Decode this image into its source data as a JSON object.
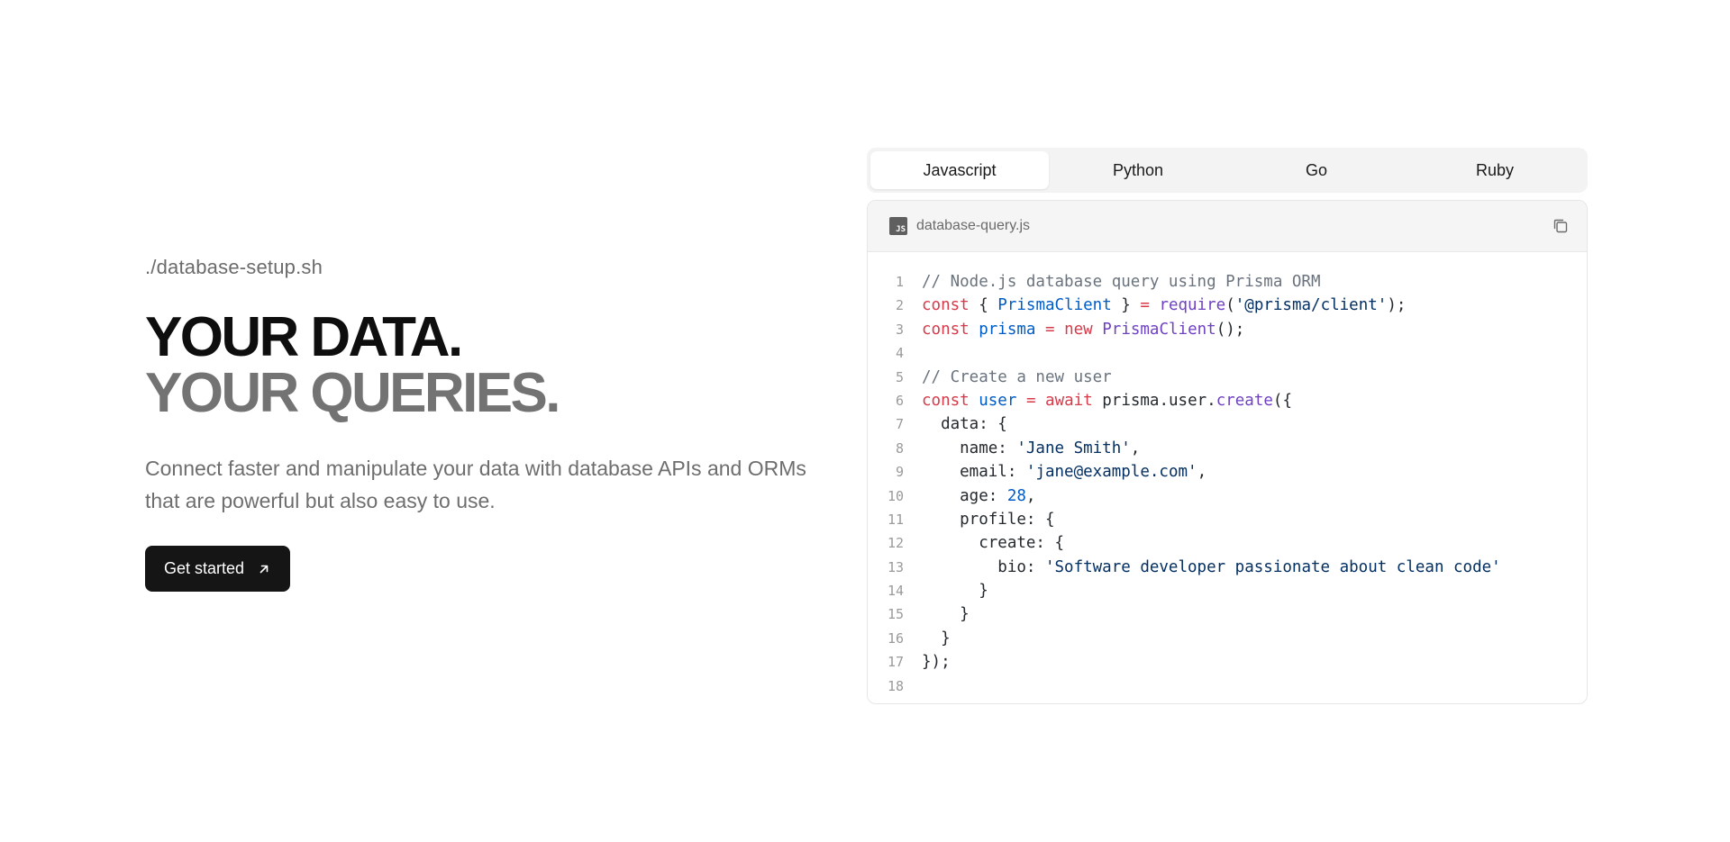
{
  "hero": {
    "filename": "./database-setup.sh",
    "headline_line1": "YOUR DATA.",
    "headline_line2": "YOUR QUERIES.",
    "subtitle": "Connect faster and manipulate your data with database APIs and ORMs that are powerful but also easy to use.",
    "cta_label": "Get started"
  },
  "tabs": [
    {
      "label": "Javascript",
      "active": true
    },
    {
      "label": "Python",
      "active": false
    },
    {
      "label": "Go",
      "active": false
    },
    {
      "label": "Ruby",
      "active": false
    }
  ],
  "editor": {
    "file_badge": "JS",
    "file_name": "database-query.js",
    "copy_icon": "copy-icon",
    "lines": [
      [
        {
          "t": "// Node.js database query using Prisma ORM",
          "k": "comment"
        }
      ],
      [
        {
          "t": "const",
          "k": "kw"
        },
        {
          "t": " { ",
          "k": "plain"
        },
        {
          "t": "PrismaClient",
          "k": "var"
        },
        {
          "t": " } ",
          "k": "plain"
        },
        {
          "t": "=",
          "k": "kw"
        },
        {
          "t": " ",
          "k": "plain"
        },
        {
          "t": "require",
          "k": "fn"
        },
        {
          "t": "(",
          "k": "plain"
        },
        {
          "t": "'@prisma/client'",
          "k": "str"
        },
        {
          "t": ");",
          "k": "plain"
        }
      ],
      [
        {
          "t": "const",
          "k": "kw"
        },
        {
          "t": " ",
          "k": "plain"
        },
        {
          "t": "prisma",
          "k": "var"
        },
        {
          "t": " ",
          "k": "plain"
        },
        {
          "t": "=",
          "k": "kw"
        },
        {
          "t": " ",
          "k": "plain"
        },
        {
          "t": "new",
          "k": "kw"
        },
        {
          "t": " ",
          "k": "plain"
        },
        {
          "t": "PrismaClient",
          "k": "fn"
        },
        {
          "t": "();",
          "k": "plain"
        }
      ],
      [],
      [
        {
          "t": "// Create a new user",
          "k": "comment"
        }
      ],
      [
        {
          "t": "const",
          "k": "kw"
        },
        {
          "t": " ",
          "k": "plain"
        },
        {
          "t": "user",
          "k": "var"
        },
        {
          "t": " ",
          "k": "plain"
        },
        {
          "t": "=",
          "k": "kw"
        },
        {
          "t": " ",
          "k": "plain"
        },
        {
          "t": "await",
          "k": "kw"
        },
        {
          "t": " prisma.user.",
          "k": "plain"
        },
        {
          "t": "create",
          "k": "fn"
        },
        {
          "t": "({",
          "k": "plain"
        }
      ],
      [
        {
          "t": "  data: {",
          "k": "plain"
        }
      ],
      [
        {
          "t": "    name: ",
          "k": "plain"
        },
        {
          "t": "'Jane Smith'",
          "k": "str"
        },
        {
          "t": ",",
          "k": "plain"
        }
      ],
      [
        {
          "t": "    email: ",
          "k": "plain"
        },
        {
          "t": "'jane@example.com'",
          "k": "str"
        },
        {
          "t": ",",
          "k": "plain"
        }
      ],
      [
        {
          "t": "    age: ",
          "k": "plain"
        },
        {
          "t": "28",
          "k": "num"
        },
        {
          "t": ",",
          "k": "plain"
        }
      ],
      [
        {
          "t": "    profile: {",
          "k": "plain"
        }
      ],
      [
        {
          "t": "      create: {",
          "k": "plain"
        }
      ],
      [
        {
          "t": "        bio: ",
          "k": "plain"
        },
        {
          "t": "'Software developer passionate about clean code'",
          "k": "str"
        }
      ],
      [
        {
          "t": "      }",
          "k": "plain"
        }
      ],
      [
        {
          "t": "    }",
          "k": "plain"
        }
      ],
      [
        {
          "t": "  }",
          "k": "plain"
        }
      ],
      [
        {
          "t": "});",
          "k": "plain"
        }
      ],
      []
    ]
  }
}
